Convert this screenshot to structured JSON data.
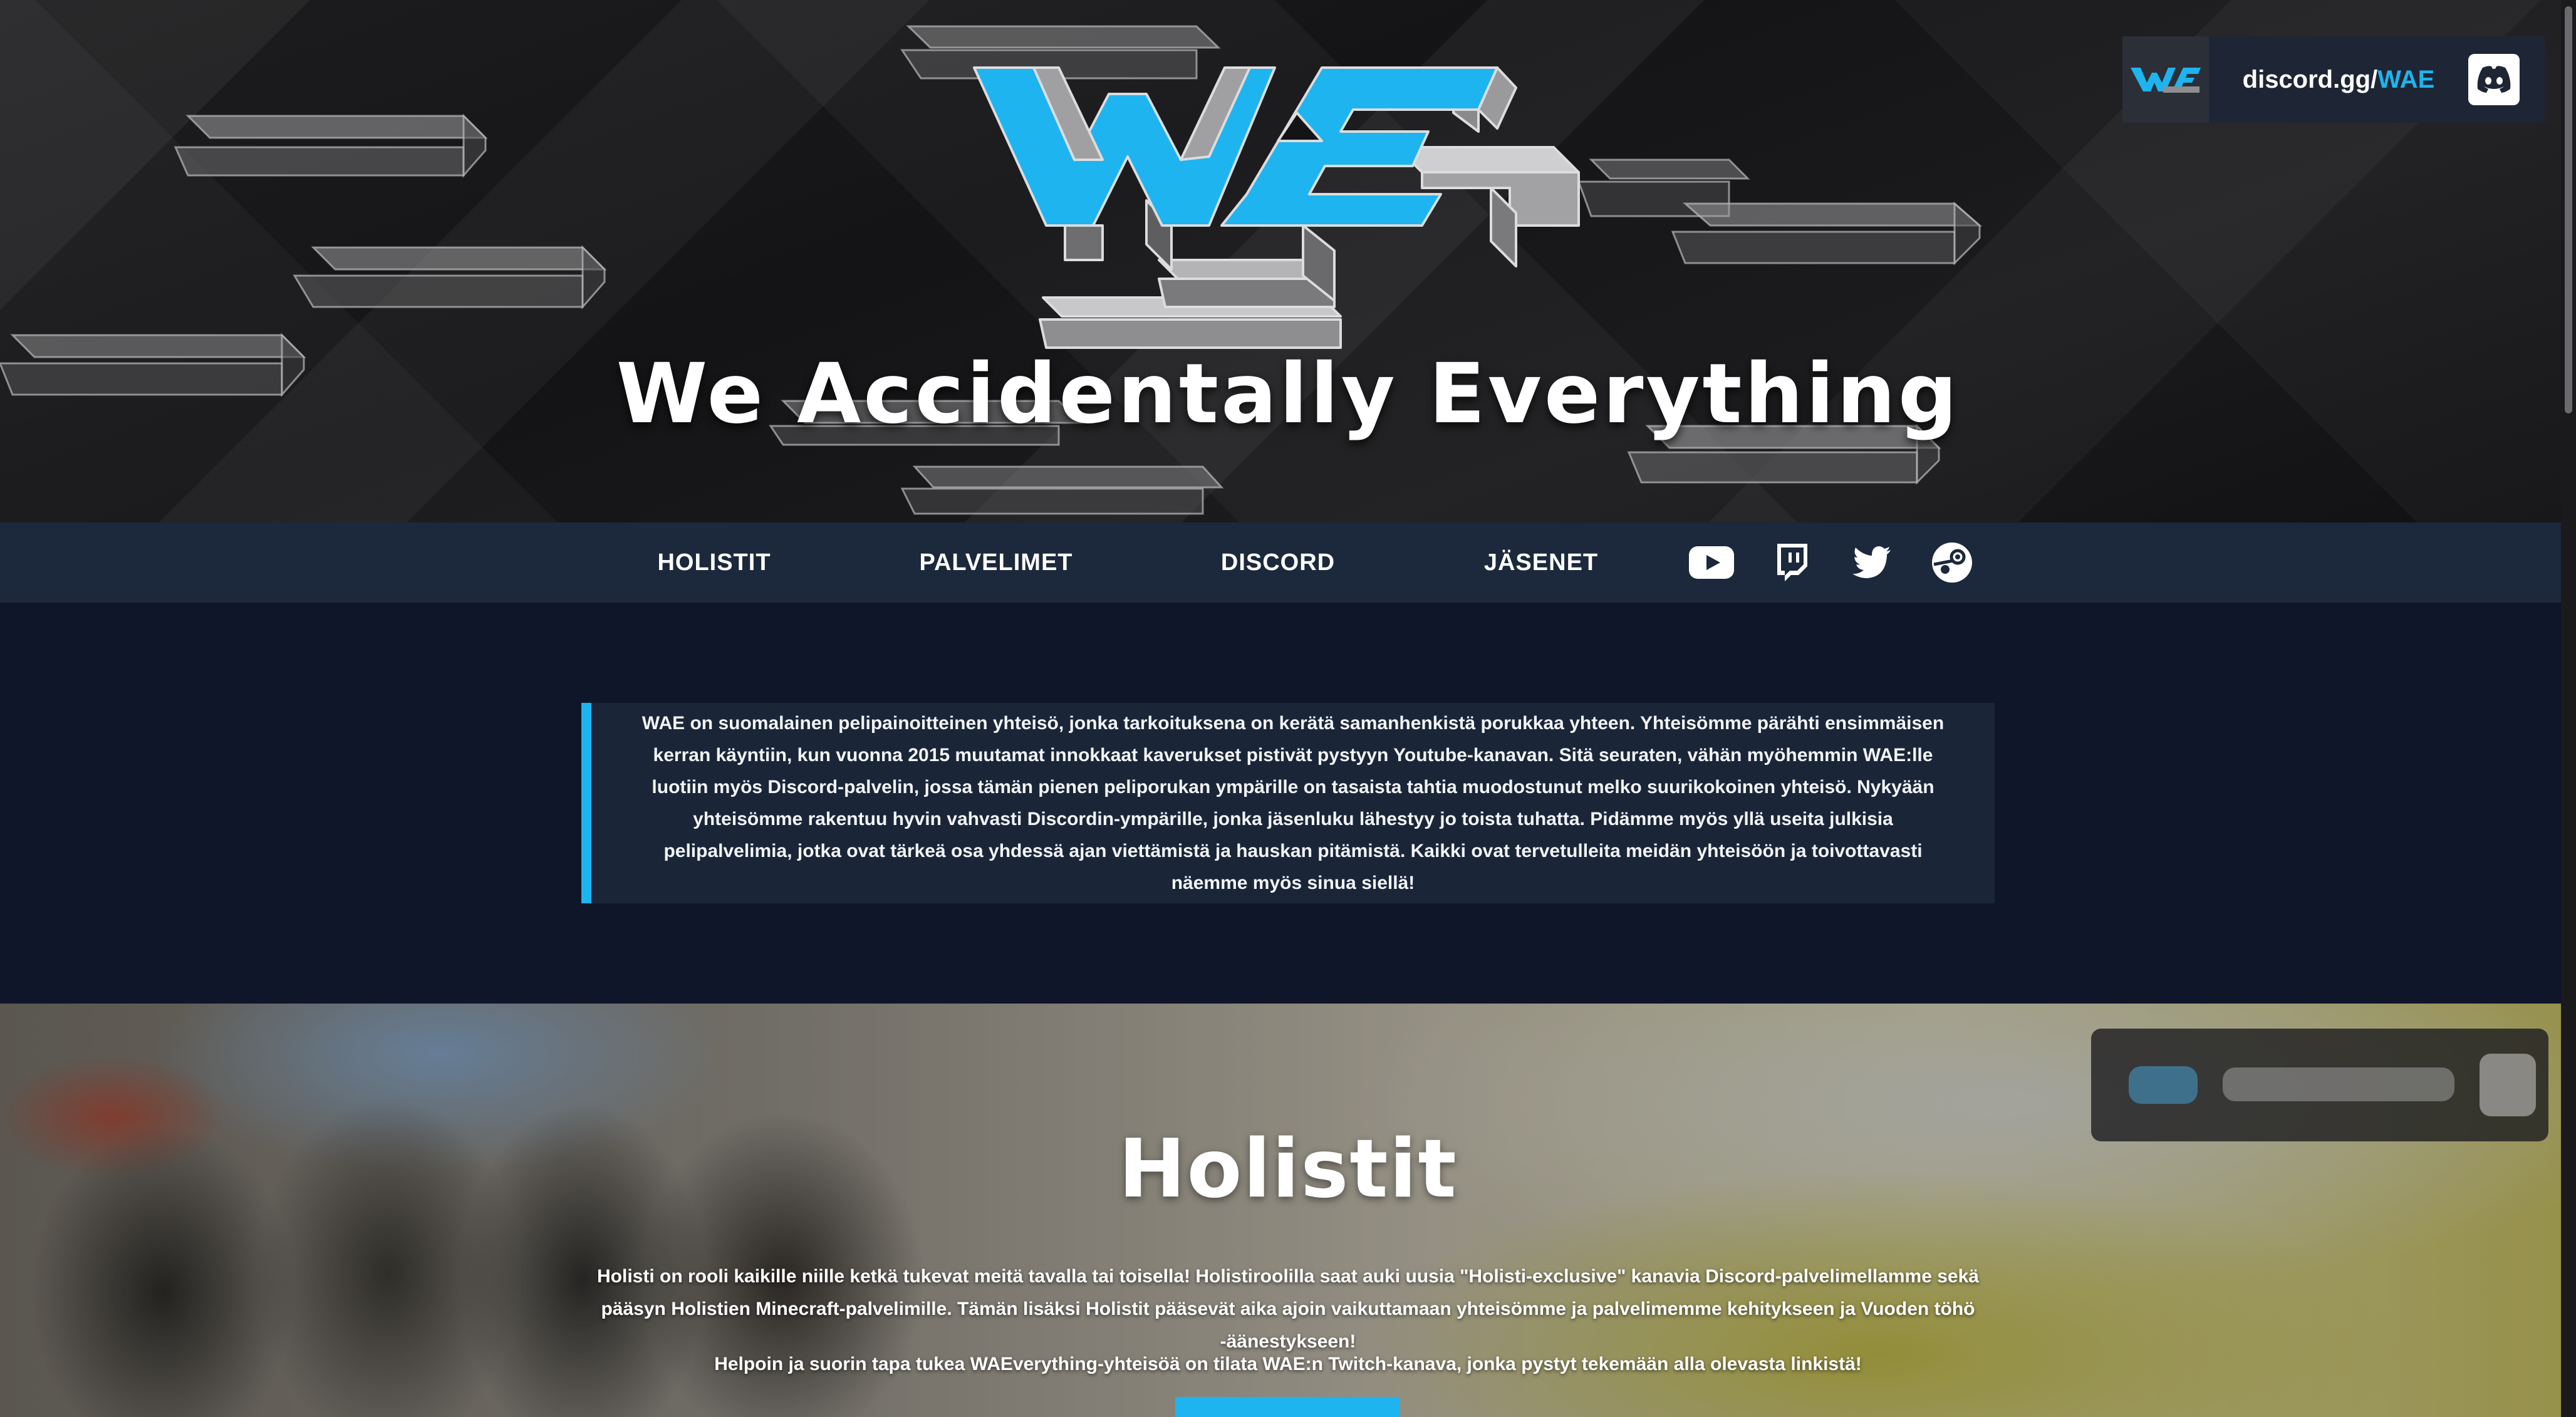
{
  "hero": {
    "title": "We Accidentally Everything"
  },
  "discord_widget": {
    "invite_prefix": "discord.gg/",
    "invite_code": "WAE"
  },
  "nav": {
    "items": [
      {
        "label": "HOLISTIT"
      },
      {
        "label": "PALVELIMET"
      },
      {
        "label": "DISCORD"
      },
      {
        "label": "JÄSENET"
      }
    ],
    "social_icons": [
      "youtube-icon",
      "twitch-icon",
      "twitter-icon",
      "steam-icon"
    ]
  },
  "about": {
    "text": "WAE on suomalainen pelipainoitteinen yhteisö, jonka tarkoituksena on kerätä samanhenkistä porukkaa yhteen. Yhteisömme pärähti ensimmäisen kerran käyntiin, kun vuonna 2015 muutamat innokkaat kaverukset pistivät pystyyn Youtube-kanavan. Sitä seuraten, vähän myöhemmin WAE:lle luotiin myös Discord-palvelin, jossa tämän pienen peliporukan ympärille on tasaista tahtia muodostunut melko suurikokoinen yhteisö. Nykyään yhteisömme rakentuu hyvin vahvasti Discordin-ympärille, jonka jäsenluku lähestyy jo toista tuhatta. Pidämme myös yllä useita julkisia pelipalvelimia, jotka ovat tärkeä osa yhdessä ajan viettämistä ja hauskan pitämistä. Kaikki ovat tervetulleita meidän yhteisöön ja toivottavasti näemme myös sinua siellä!"
  },
  "holistit": {
    "title": "Holistit",
    "paragraph1": "Holisti on rooli kaikille niille ketkä tukevat meitä tavalla tai toisella! Holistiroolilla saat auki uusia \"Holisti-exclusive\" kanavia Discord-palvelimellamme sekä pääsyn Holistien Minecraft-palvelimille. Tämän lisäksi Holistit pääsevät aika ajoin vaikuttamaan yhteisömme ja palvelimemme kehitykseen ja Vuoden töhö -äänestykseen!",
    "paragraph2": "Helpoin ja suorin tapa tukea WAEverything-yhteisöä on tilata WAE:n Twitch-kanava, jonka pystyt tekemään alla olevasta linkistä!"
  },
  "colors": {
    "accent": "#1eb4ef",
    "nav_bg": "#1c283b",
    "page_bg": "#0f1629"
  }
}
